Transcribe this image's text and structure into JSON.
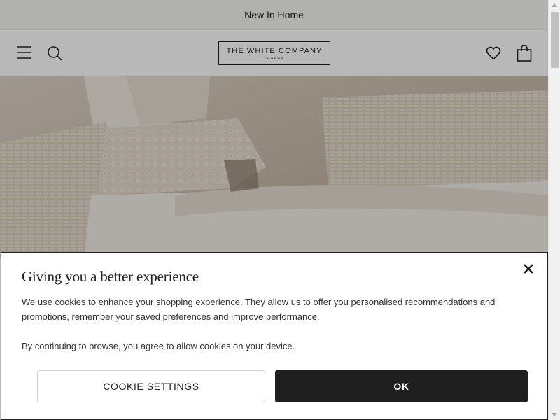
{
  "promo": {
    "text": "New In Home"
  },
  "header": {
    "logo_main": "THE WHITE COMPANY",
    "logo_sub": "LONDON",
    "icons": [
      "hamburger-menu-icon",
      "search-icon",
      "heart-icon",
      "bag-icon"
    ]
  },
  "hero": {
    "image": "cream-knitted-cushions-on-bed"
  },
  "cookie": {
    "title": "Giving you a better experience",
    "body": "We use cookies to enhance your shopping experience. They allow us to offer you personalised recommendations and promotions, remember your saved preferences and improve performance.",
    "consent": "By continuing to browse, you agree to allow cookies on your device.",
    "settings_label": "COOKIE SETTINGS",
    "ok_label": "OK",
    "close_icon": "close-icon"
  },
  "colors": {
    "promo_bg": "#f6f5f2",
    "button_dark": "#1f1f1f",
    "overlay": "rgba(0,0,0,0.28)"
  }
}
